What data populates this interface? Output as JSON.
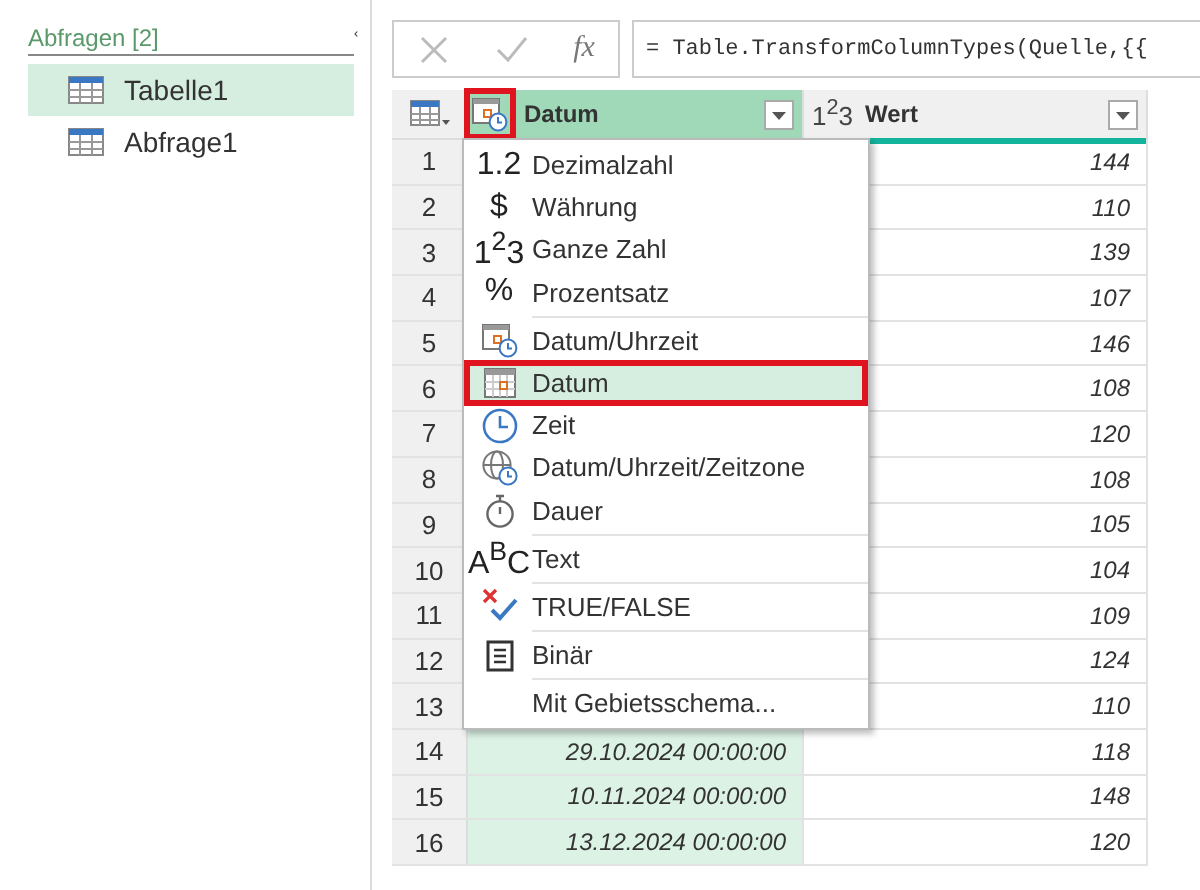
{
  "sidebar": {
    "header": "Abfragen [2]",
    "items": [
      {
        "label": "Tabelle1",
        "selected": true
      },
      {
        "label": "Abfrage1",
        "selected": false
      }
    ]
  },
  "formula_bar": {
    "fx": "fx",
    "formula": "= Table.TransformColumnTypes(Quelle,{{"
  },
  "table": {
    "columns": [
      {
        "label": "Datum",
        "kind": "datetime",
        "selected": true,
        "highlighted": true
      },
      {
        "label": "Wert",
        "type_glyph": "1$^{2}$3",
        "kind": "number",
        "selected": false
      }
    ],
    "rows": [
      {
        "n": "1",
        "value": "144"
      },
      {
        "n": "2",
        "value": "110"
      },
      {
        "n": "3",
        "value": "139"
      },
      {
        "n": "4",
        "value": "107"
      },
      {
        "n": "5",
        "value": "146"
      },
      {
        "n": "6",
        "value": "108"
      },
      {
        "n": "7",
        "value": "120"
      },
      {
        "n": "8",
        "value": "108"
      },
      {
        "n": "9",
        "value": "105"
      },
      {
        "n": "10",
        "value": "104"
      },
      {
        "n": "11",
        "value": "109"
      },
      {
        "n": "12",
        "value": "124"
      },
      {
        "n": "13",
        "value": "110"
      },
      {
        "n": "14",
        "date": "29.10.2024 00:00:00",
        "value": "118"
      },
      {
        "n": "15",
        "date": "10.11.2024 00:00:00",
        "value": "148"
      },
      {
        "n": "16",
        "date": "13.12.2024 00:00:00",
        "value": "120"
      }
    ]
  },
  "type_menu": {
    "groups": [
      [
        {
          "kind": "glyph",
          "glyph": "1.2",
          "label": "Dezimalzahl",
          "selected": false,
          "highlighted": false
        },
        {
          "kind": "glyph",
          "glyph": "$",
          "label": "Währung",
          "selected": false,
          "highlighted": false
        },
        {
          "kind": "glyph",
          "glyph": "1$^{2}$3",
          "label": "Ganze Zahl",
          "selected": false,
          "highlighted": false
        },
        {
          "kind": "glyph",
          "glyph": "%",
          "label": "Prozentsatz",
          "selected": false,
          "highlighted": false
        }
      ],
      [
        {
          "kind": "datetime",
          "label": "Datum/Uhrzeit",
          "selected": false,
          "highlighted": false
        },
        {
          "kind": "date",
          "label": "Datum",
          "selected": true,
          "highlighted": true
        },
        {
          "kind": "time",
          "label": "Zeit",
          "selected": false,
          "highlighted": false
        },
        {
          "kind": "timezone",
          "label": "Datum/Uhrzeit/Zeitzone",
          "selected": false,
          "highlighted": false
        },
        {
          "kind": "duration",
          "label": "Dauer",
          "selected": false,
          "highlighted": false
        }
      ],
      [
        {
          "kind": "glyph",
          "glyph": "A$^{B}$C",
          "label": "Text",
          "selected": false,
          "highlighted": false
        }
      ],
      [
        {
          "kind": "boolean",
          "label": "TRUE/FALSE",
          "selected": false,
          "highlighted": false
        }
      ],
      [
        {
          "kind": "binary",
          "label": "Binär",
          "selected": false,
          "highlighted": false
        }
      ],
      [
        {
          "kind": "none",
          "label": "Mit Gebietsschema...",
          "selected": false,
          "highlighted": false
        }
      ]
    ]
  }
}
